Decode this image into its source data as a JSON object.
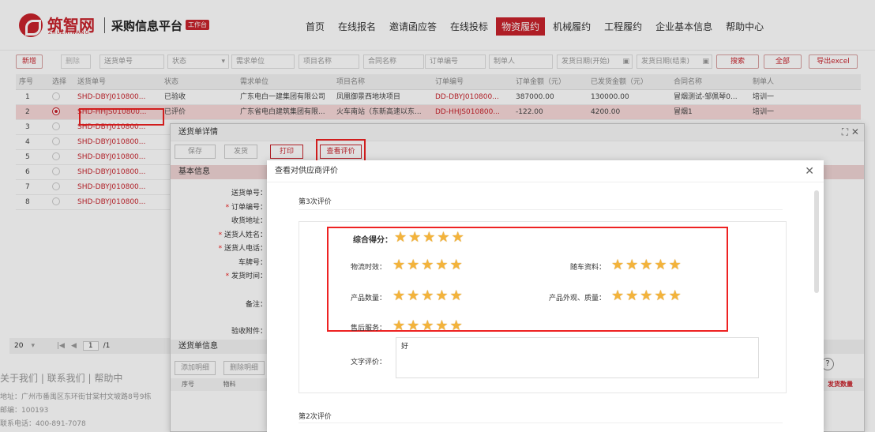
{
  "header": {
    "logo_text": "筑智网",
    "logo_sub": "ZHUZHIWANG",
    "platform": "采购信息平台",
    "badge": "工作台",
    "nav": [
      "首页",
      "在线报名",
      "邀请函应答",
      "在线投标",
      "物资履约",
      "机械履约",
      "工程履约",
      "企业基本信息",
      "帮助中心"
    ],
    "nav_active": 4
  },
  "toolbar": {
    "add": "新增",
    "delete": "删除",
    "f_no": "送货单号",
    "f_status": "状态",
    "f_unit": "需求单位",
    "f_proj": "项目名称",
    "f_contract": "合同名称",
    "f_order": "订单编号",
    "f_maker": "制单人",
    "f_start": "发货日期(开始)",
    "f_end": "发货日期(结束)",
    "search": "搜索",
    "all": "全部",
    "export": "导出excel"
  },
  "grid": {
    "headers": [
      "序号",
      "选择",
      "送货单号",
      "状态",
      "需求单位",
      "项目名称",
      "订单编号",
      "订单金额（元）",
      "已发货金额（元）",
      "合同名称",
      "制单人"
    ],
    "rows": [
      {
        "no": "1",
        "sel": false,
        "code": "SHD-DBYJ010800...",
        "status": "已验收",
        "unit": "广东电白一建集团有限公司",
        "proj": "凤凰御景西地块项目",
        "order": "DD-DBYJ010800...",
        "amount": "387000.00",
        "shipped": "130000.00",
        "contract": "冒烟测试-邹佩琴0...",
        "maker": "培训一"
      },
      {
        "no": "2",
        "sel": true,
        "code": "SHD-HHJS010800...",
        "status": "已评价",
        "unit": "广东省电白建筑集团有限...",
        "proj": "火车南站（东新高速以东...",
        "order": "DD-HHJS010800...",
        "amount": "-122.00",
        "shipped": "4200.00",
        "contract": "冒烟1",
        "maker": "培训一"
      },
      {
        "no": "3",
        "sel": false,
        "code": "SHD-DBYJ010800..."
      },
      {
        "no": "4",
        "sel": false,
        "code": "SHD-DBYJ010800..."
      },
      {
        "no": "5",
        "sel": false,
        "code": "SHD-DBYJ010800..."
      },
      {
        "no": "6",
        "sel": false,
        "code": "SHD-DBYJ010800..."
      },
      {
        "no": "7",
        "sel": false,
        "code": "SHD-DBYJ010800..."
      },
      {
        "no": "8",
        "sel": false,
        "code": "SHD-DBYJ010800..."
      }
    ]
  },
  "pager": {
    "size": "20",
    "page": "1",
    "total": "/1"
  },
  "footer": {
    "links": "关于我们 | 联系我们 | 帮助中",
    "addr": "地址：广州市番禺区东环街甘棠村文坡路8号9栋",
    "zip": "邮编：100193",
    "tel": "联系电话：400-891-7078"
  },
  "detail": {
    "title": "送货单详情",
    "btn_save": "保存",
    "btn_ship": "发货",
    "btn_print": "打印",
    "btn_review": "查看评价",
    "sec_basic": "基本信息",
    "fields": [
      {
        "label": "送货单号：",
        "req": false
      },
      {
        "label": "订单编号：",
        "req": true
      },
      {
        "label": "收货地址：",
        "req": false
      },
      {
        "label": "送货人姓名：",
        "req": true
      },
      {
        "label": "送货人电话：",
        "req": true
      },
      {
        "label": "车牌号：",
        "req": false
      },
      {
        "label": "发货时间：",
        "req": true
      }
    ],
    "remark": "备注：",
    "attach": "验收附件：",
    "sec_items": "送货单信息",
    "btn_add_detail": "添加明细",
    "btn_del_detail": "删除明细",
    "col_no": "序号",
    "col_mat": "物料",
    "right_col": "发货数量"
  },
  "review": {
    "title": "查看对供应商评价",
    "round3": "第3次评价",
    "round2": "第2次评价",
    "score_label": "综合得分：",
    "score": 5,
    "items": [
      {
        "label": "物流时效：",
        "stars": 5
      },
      {
        "label": "随车资料：",
        "stars": 5
      },
      {
        "label": "产品数量：",
        "stars": 5
      },
      {
        "label": "产品外观、质量：",
        "stars": 5
      },
      {
        "label": "售后服务：",
        "stars": 5
      }
    ],
    "text_label": "文字评价：",
    "text": "好"
  },
  "colors": {
    "brand": "#c8232c",
    "star": "#f3b33b",
    "highlight": "#e22222"
  }
}
